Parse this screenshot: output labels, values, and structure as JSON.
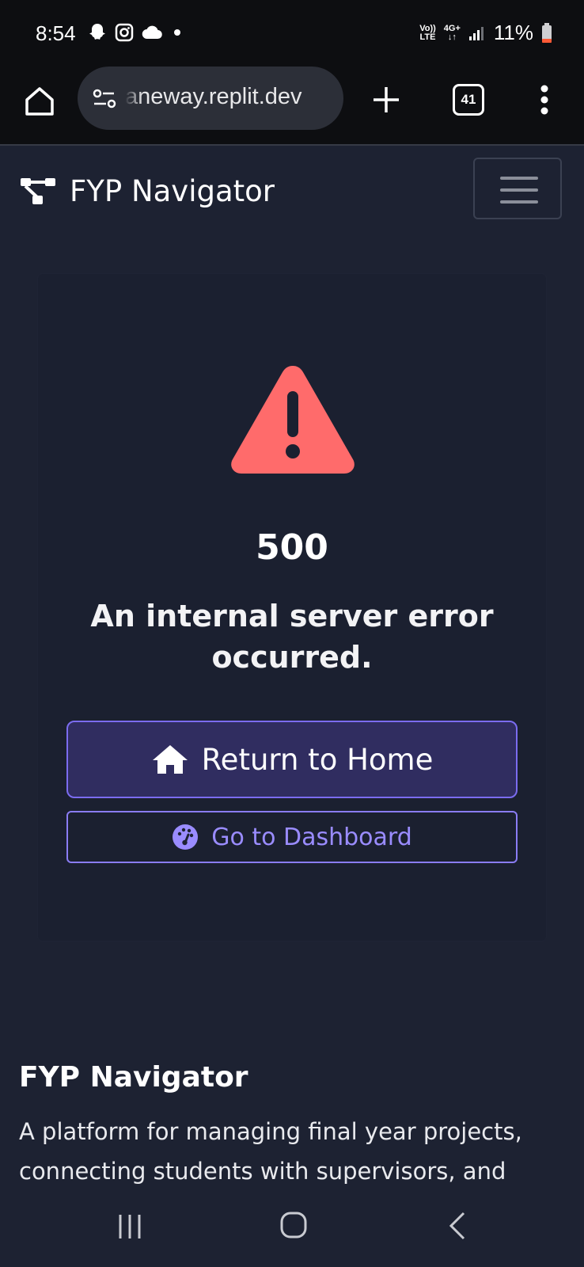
{
  "status_bar": {
    "time": "8:54",
    "notification_icons": [
      "snapchat-icon",
      "instagram-icon",
      "cloud-icon",
      "dot-icon"
    ],
    "network_volte": "Vo))",
    "network_lte": "LTE",
    "network_4g": "4G+",
    "network_arrows": "↓↑",
    "battery_percent": "11%",
    "battery_color": "#ff5a36"
  },
  "browser": {
    "url": "aneway.replit.dev",
    "tab_count": "41"
  },
  "navbar": {
    "brand_name": "FYP Navigator",
    "brand_icon": "sitemap-icon",
    "menu_icon": "hamburger-icon"
  },
  "error": {
    "icon": "warning-triangle-icon",
    "icon_color": "#ff6b6b",
    "code": "500",
    "message": "An internal server error occurred.",
    "primary_button": {
      "label": "Return to Home",
      "icon": "home-icon"
    },
    "secondary_button": {
      "label": "Go to Dashboard",
      "icon": "dashboard-icon"
    },
    "accent_color": "#7b6cf0"
  },
  "footer": {
    "title": "FYP Navigator",
    "description": "A platform for managing final year projects, connecting students with supervisors, and"
  },
  "system_nav": {
    "recent_icon": "recent-apps-icon",
    "home_icon": "home-circle-icon",
    "back_icon": "back-icon"
  }
}
